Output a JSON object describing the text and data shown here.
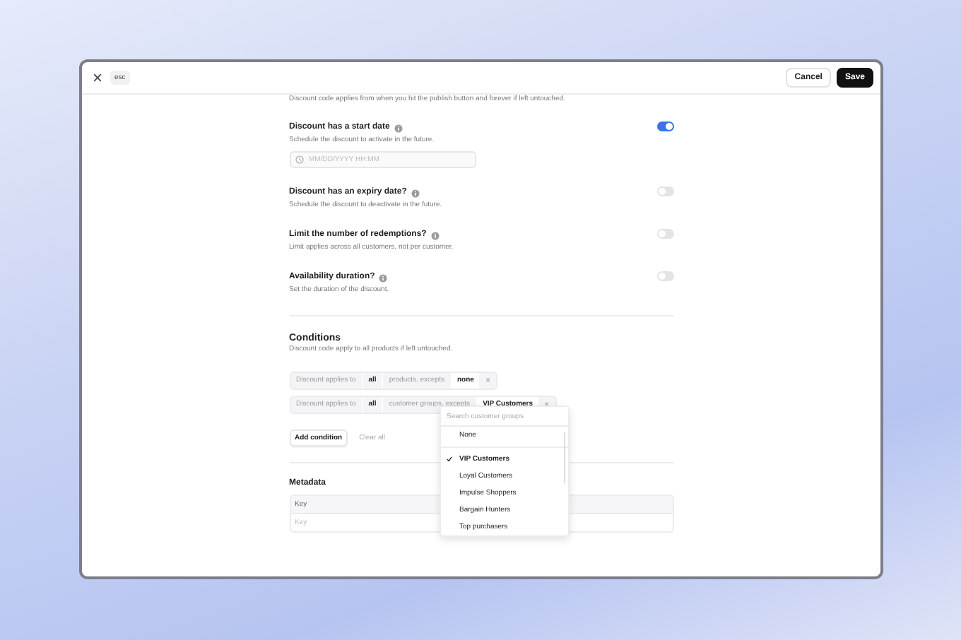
{
  "header": {
    "esc_key": "esc",
    "buttons": [
      {
        "label": "Cancel",
        "kind": "secondary"
      },
      {
        "label": "Save",
        "kind": "primary"
      }
    ]
  },
  "intro": "Discount code applies from when you hit the publish button and forever if left untouched.",
  "settings": [
    {
      "title": "Discount has a start date",
      "description": "Schedule the discount to activate in the future.",
      "on": true,
      "date_placeholder": "MM/DD/YYYY HH:MM"
    },
    {
      "title": "Discount has an expiry date?",
      "description": "Schedule the discount to deactivate in the future.",
      "on": false
    },
    {
      "title": "Limit the number of redemptions?",
      "description": "Limit applies across all customers, not per customer.",
      "on": false
    },
    {
      "title": "Availability duration?",
      "description": "Set the duration of the discount.",
      "on": false
    }
  ],
  "conditions": {
    "title": "Conditions",
    "description": "Discount code apply to all products if left untouched.",
    "rows": [
      {
        "prefix": "Discount applies to",
        "scope": "all",
        "target": "products, excepts",
        "value": "none",
        "remove": "×"
      },
      {
        "prefix": "Discount applies to",
        "scope": "all",
        "target": "customer groups, excepts",
        "value": "VIP Customers",
        "remove": "×"
      }
    ],
    "add_button": "Add condition",
    "clear_button": "Clear all"
  },
  "dropdown": {
    "placeholder": "Search customer groups",
    "none_option": "None",
    "options": [
      {
        "label": "VIP Customers",
        "selected": true
      },
      {
        "label": "Loyal Customers",
        "selected": false
      },
      {
        "label": "Impulse Shoppers",
        "selected": false
      },
      {
        "label": "Bargain Hunters",
        "selected": false
      },
      {
        "label": "Top purchasers",
        "selected": false
      }
    ]
  },
  "metadata": {
    "title": "Metadata",
    "column_1": "Key",
    "key_placeholder": "Key"
  }
}
